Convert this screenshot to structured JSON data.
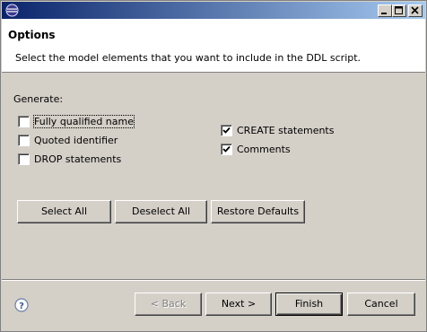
{
  "header": {
    "title": "Options",
    "description": "Select the model elements that you want to include in the DDL script."
  },
  "generate": {
    "label": "Generate:",
    "left_options": [
      {
        "label": "Fully qualified name",
        "checked": false
      },
      {
        "label": "Quoted identifier",
        "checked": false
      },
      {
        "label": "DROP statements",
        "checked": false
      }
    ],
    "right_options": [
      {
        "label": "CREATE statements",
        "checked": true
      },
      {
        "label": "Comments",
        "checked": true
      }
    ]
  },
  "actions": {
    "select_all": "Select All",
    "deselect_all": "Deselect All",
    "restore_defaults": "Restore Defaults"
  },
  "footer": {
    "back": "< Back",
    "next": "Next >",
    "finish": "Finish",
    "cancel": "Cancel"
  },
  "colors": {
    "title_gradient_start": "#0a246a",
    "title_gradient_end": "#a6caf0",
    "dialog_bg": "#d4d0c8"
  }
}
